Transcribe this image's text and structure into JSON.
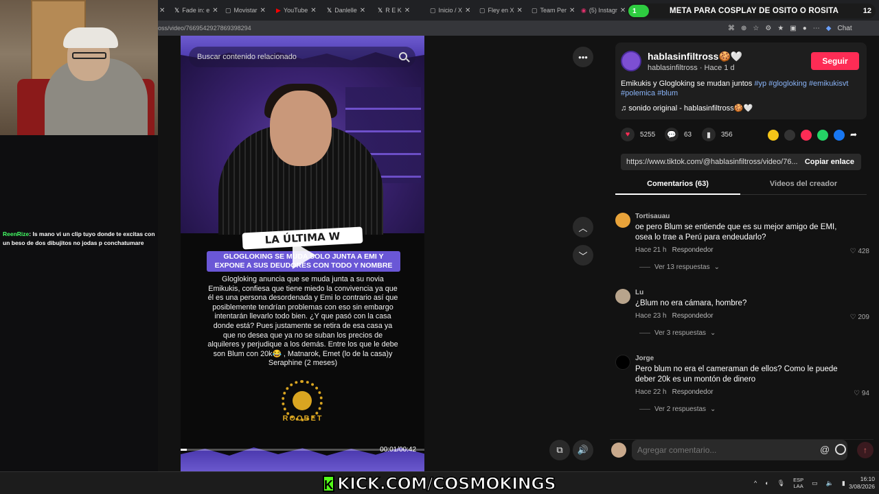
{
  "browser": {
    "tabs": [
      {
        "label": "Fade in: e"
      },
      {
        "label": "Movistar"
      },
      {
        "label": "YouTube"
      },
      {
        "label": "Danlelle"
      },
      {
        "label": "R E K"
      },
      {
        "label": "Inicio / X"
      },
      {
        "label": "Fley en X"
      },
      {
        "label": "Team Per"
      },
      {
        "label": "(5) Instagr"
      }
    ],
    "url": "oss/video/7669542927869398294",
    "chat_label": "Chat"
  },
  "stream_overlay": {
    "goal_count_left": "1",
    "goal_text": "META PARA COSPLAY DE OSITO O ROSITA",
    "goal_count_right": "12",
    "chat_user": "ReenRize",
    "chat_message": ": Is mano vi un clip tuyo donde te excitas con un beso de dos dibujitos no jodas p conchatumare",
    "kick_banner": "KICK.COM/COSMOKINGS"
  },
  "video": {
    "search_placeholder": "Buscar contenido relacionado",
    "ultima_tag": "LA ÚLTIMA W",
    "headline": "GLOGLOKING SE MUDA SOLO JUNTA A EMI Y EXPONE A SUS DEUDORES CON TODO Y NOMBRE",
    "body": "Glogloking anuncia que se muda junta a su novia Emikukis, confiesa que tiene miedo la convivencia ya que él es una persona desordenada y Emi lo contrario así que posiblemente tendrían problemas con eso sin embargo intentarán llevarlo todo bien. ¿Y que pasó con la casa donde está? Pues justamente se retira de esa casa ya que no desea que ya no se suban los precios de alquileres y perjudique a los demás. Entre los que le debe son Blum con 20k😂 , Matnarok, Emet (lo de la casa)y Seraphine (2 meses)",
    "logo_text": "ROOBET",
    "timecode": "00:01/00:42",
    "progress": 0.024
  },
  "post": {
    "author": "hablasinfiltross🍪🤍",
    "subline": "hablasinfiltross · Hace 1 d",
    "follow_label": "Seguir",
    "caption_text": "Emikukis y Glogloking se mudan juntos ",
    "hashtags": "#yp #glogloking #emikukisvt #polemica #blum",
    "sound": "♫  sonido original - hablasinfiltross🍪🤍",
    "likes": "5255",
    "comments": "63",
    "saves": "356",
    "link": "https://www.tiktok.com/@hablasinfiltross/video/76...",
    "copy_label": "Copiar enlace",
    "tab_comments": "Comentarios (63)",
    "tab_videos": "Videos del creador"
  },
  "comments": [
    {
      "user": "Tortisauau",
      "text": "oe pero Blum se entiende que es su mejor amigo de EMI, osea lo trae a Perú para endeudarlo?",
      "time": "Hace 21 h",
      "reply": "Respondedor",
      "likes": "428",
      "more": "Ver 13 respuestas"
    },
    {
      "user": "Lu",
      "text": "¿Blum no era cámara, hombre?",
      "time": "Hace 23 h",
      "reply": "Respondedor",
      "likes": "209",
      "more": "Ver 3 respuestas"
    },
    {
      "user": "Jorge",
      "text": "Pero blum no era el cameraman de ellos? Como le puede deber 20k es un montón de dinero",
      "time": "Hace 22 h",
      "reply": "Respondedor",
      "likes": "94",
      "more": "Ver 2 respuestas"
    }
  ],
  "composer": {
    "placeholder": "Agregar comentario..."
  },
  "taskbar": {
    "lang_top": "ESP",
    "lang_bottom": "LAA",
    "time": "16:10",
    "date": "3/08/2026"
  },
  "colors": {
    "follow": "#fe2c55",
    "hashtag": "#8ab4f8",
    "kick_green": "#53fc18"
  }
}
